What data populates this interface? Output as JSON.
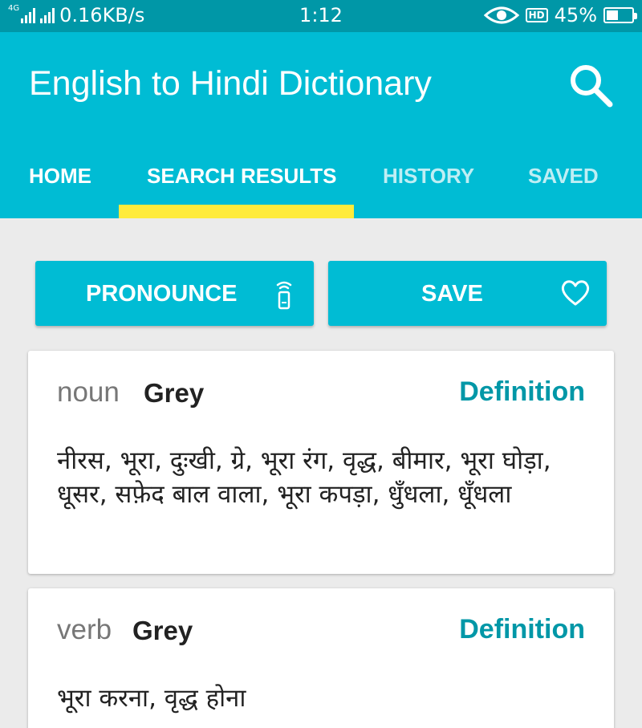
{
  "status_bar": {
    "network_type": "4G",
    "speed": "0.16KB/s",
    "time": "1:12",
    "hd_label": "HD",
    "battery": "45%",
    "battery_level": 0.45
  },
  "app_bar": {
    "title": "English to Hindi Dictionary",
    "search_icon": "search-icon"
  },
  "tabs": [
    {
      "label": "HOME",
      "active": false
    },
    {
      "label": "SEARCH RESULTS",
      "active": true
    },
    {
      "label": "HISTORY",
      "active": false
    },
    {
      "label": "SAVED",
      "active": false
    }
  ],
  "actions": {
    "pronounce_label": "PRONOUNCE",
    "pronounce_icon": "speaker-icon",
    "save_label": "SAVE",
    "save_icon": "heart-icon"
  },
  "results": [
    {
      "part_of_speech": "noun",
      "word": "Grey",
      "definition_label": "Definition",
      "meanings": "नीरस, भूरा, दुःखी, ग्रे, भूरा रंग, वृद्ध, बीमार, भूरा घोड़ा, धूसर, सफ़ेद बाल वाला, भूरा कपड़ा, धुँधला, धूँधला"
    },
    {
      "part_of_speech": "verb",
      "word": "Grey",
      "definition_label": "Definition",
      "meanings": "भूरा करना, वृद्ध होना"
    }
  ],
  "colors": {
    "primary": "#00bcd4",
    "primary_dark": "#0097a7",
    "indicator": "#ffeb3b",
    "background": "#ebebeb"
  }
}
